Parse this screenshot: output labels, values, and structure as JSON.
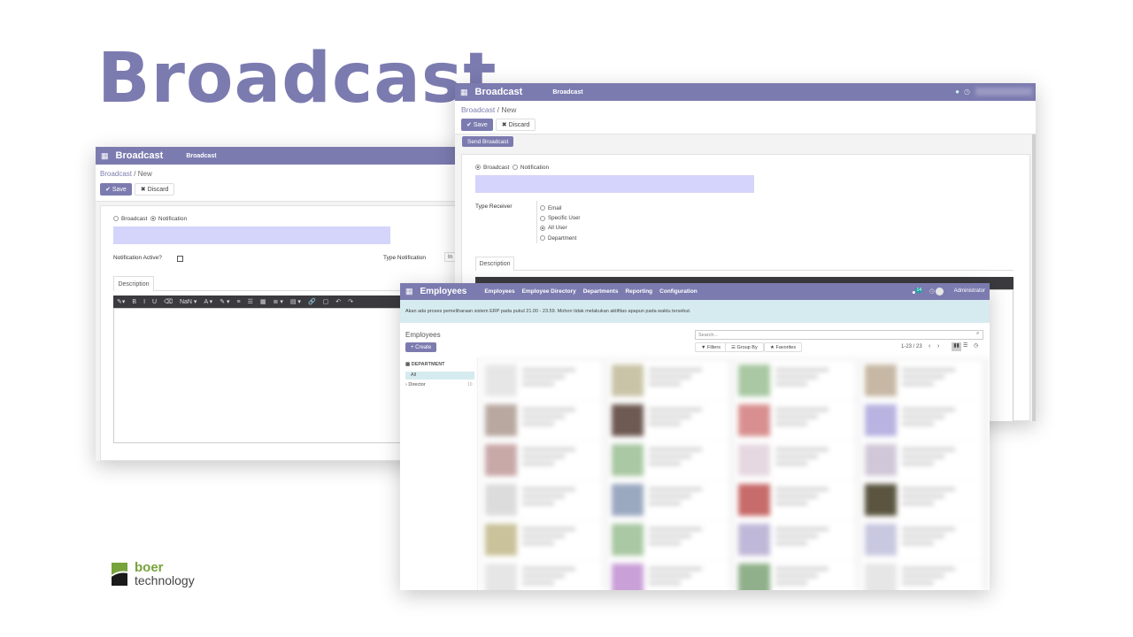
{
  "hero": {
    "title": "Broadcast"
  },
  "win1": {
    "apps_icon": "grid-icon",
    "app_title": "Broadcast",
    "menu_item": "Broadcast",
    "breadcrumb": {
      "parent": "Broadcast",
      "sep": "/",
      "current": "New"
    },
    "save_label": "Save",
    "discard_label": "Discard",
    "radio_broadcast": "Broadcast",
    "radio_notification": "Notification",
    "notification_active_label": "Notification Active?",
    "type_notification_label": "Type Notification",
    "type_notification_value": "In",
    "description_tab": "Description",
    "toolbar": [
      "✎▾",
      "B",
      "I",
      "U",
      "⌫",
      "NaN ▾",
      "A ▾",
      "✎ ▾",
      "≡",
      "☰",
      "▦",
      "≣ ▾",
      "▤ ▾",
      "🔗",
      "▢",
      "↶",
      "↷"
    ]
  },
  "win2": {
    "apps_icon": "grid-icon",
    "app_title": "Broadcast",
    "menu_item": "Broadcast",
    "breadcrumb": {
      "parent": "Broadcast",
      "sep": "/",
      "current": "New"
    },
    "save_label": "Save",
    "discard_label": "Discard",
    "send_broadcast_label": "Send Broadcast",
    "radio_broadcast": "Broadcast",
    "radio_notification": "Notification",
    "type_receiver_label": "Type Receiver",
    "receivers": [
      {
        "label": "Email",
        "selected": false
      },
      {
        "label": "Specific User",
        "selected": false
      },
      {
        "label": "All User",
        "selected": true
      },
      {
        "label": "Department",
        "selected": false
      }
    ],
    "description_tab": "Description"
  },
  "win3": {
    "apps_icon": "grid-icon",
    "app_title": "Employees",
    "menu": [
      "Employees",
      "Employee Directory",
      "Departments",
      "Reporting",
      "Configuration"
    ],
    "chat_badge": "14",
    "user_name": "Administrator",
    "notice": "Akan ada proses pemeliharaan sistem ERP pada pukul 21.00 - 23.59. Mohon tidak melakukan aktifitas apapun pada waktu tersebut.",
    "page_title": "Employees",
    "create_label": "+ Create",
    "search_placeholder": "Search...",
    "filters_label": "▼ Filters",
    "groupby_label": "☰ Group By",
    "favorites_label": "★ Favorites",
    "pager": "1-23 / 23",
    "department_header": "DEPARTMENT",
    "dept_all": "All",
    "dept_director": "Director",
    "dept_director_count": "10"
  },
  "logo": {
    "line1": "boer",
    "line2": "technology"
  },
  "colors": {
    "accent": "#7c7bb0",
    "lavender_field": "#d5d4fb",
    "notice_bg": "#d6ebf0",
    "brand_green": "#77a33b"
  }
}
